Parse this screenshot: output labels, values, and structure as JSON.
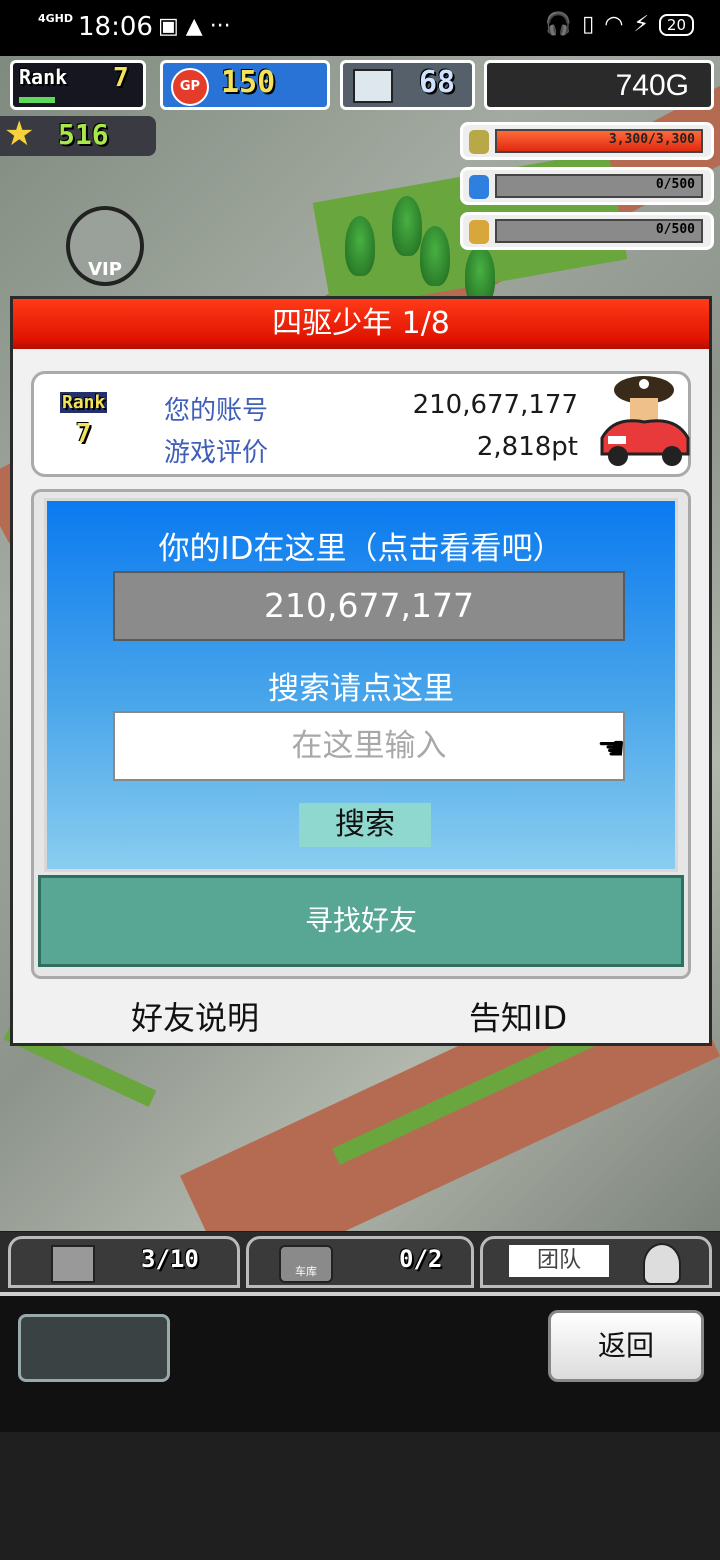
{
  "status_bar": {
    "signal": "4GHD",
    "time": "18:06",
    "battery": "20"
  },
  "hud": {
    "rank_label": "Rank",
    "rank_value": "7",
    "gp_label": "GP",
    "gp_value": "150",
    "pc_value": "68",
    "gold": "740G",
    "stars": "516",
    "resources": [
      {
        "icon": "coin-stack-icon",
        "value": "3,300/3,300",
        "fill_ratio": 1.0
      },
      {
        "icon": "bottle-icon",
        "value": "0/500",
        "fill_ratio": 0
      },
      {
        "icon": "wheat-icon",
        "value": "0/500",
        "fill_ratio": 0
      }
    ],
    "vip_label": "VIP"
  },
  "dialog": {
    "title": "四驱少年 1/8",
    "profile": {
      "rank_label": "Rank",
      "rank_value": "7",
      "account_label": "您的账号",
      "account_value": "210,677,177",
      "rating_label": "游戏评价",
      "rating_value": "2,818pt"
    },
    "id_hint": "你的ID在这里（点击看看吧）",
    "id_value": "210,677,177",
    "search_hint": "搜索请点这里",
    "search_placeholder": "在这里输入",
    "search_button": "搜索",
    "find_friends_button": "寻找好友",
    "friend_help": "好友说明",
    "tell_id": "告知ID"
  },
  "toolbar": {
    "box_count": "3/10",
    "garage_label": "车库",
    "garage_count": "0/2",
    "team_label": "团队"
  },
  "bottom": {
    "back_button": "返回"
  }
}
